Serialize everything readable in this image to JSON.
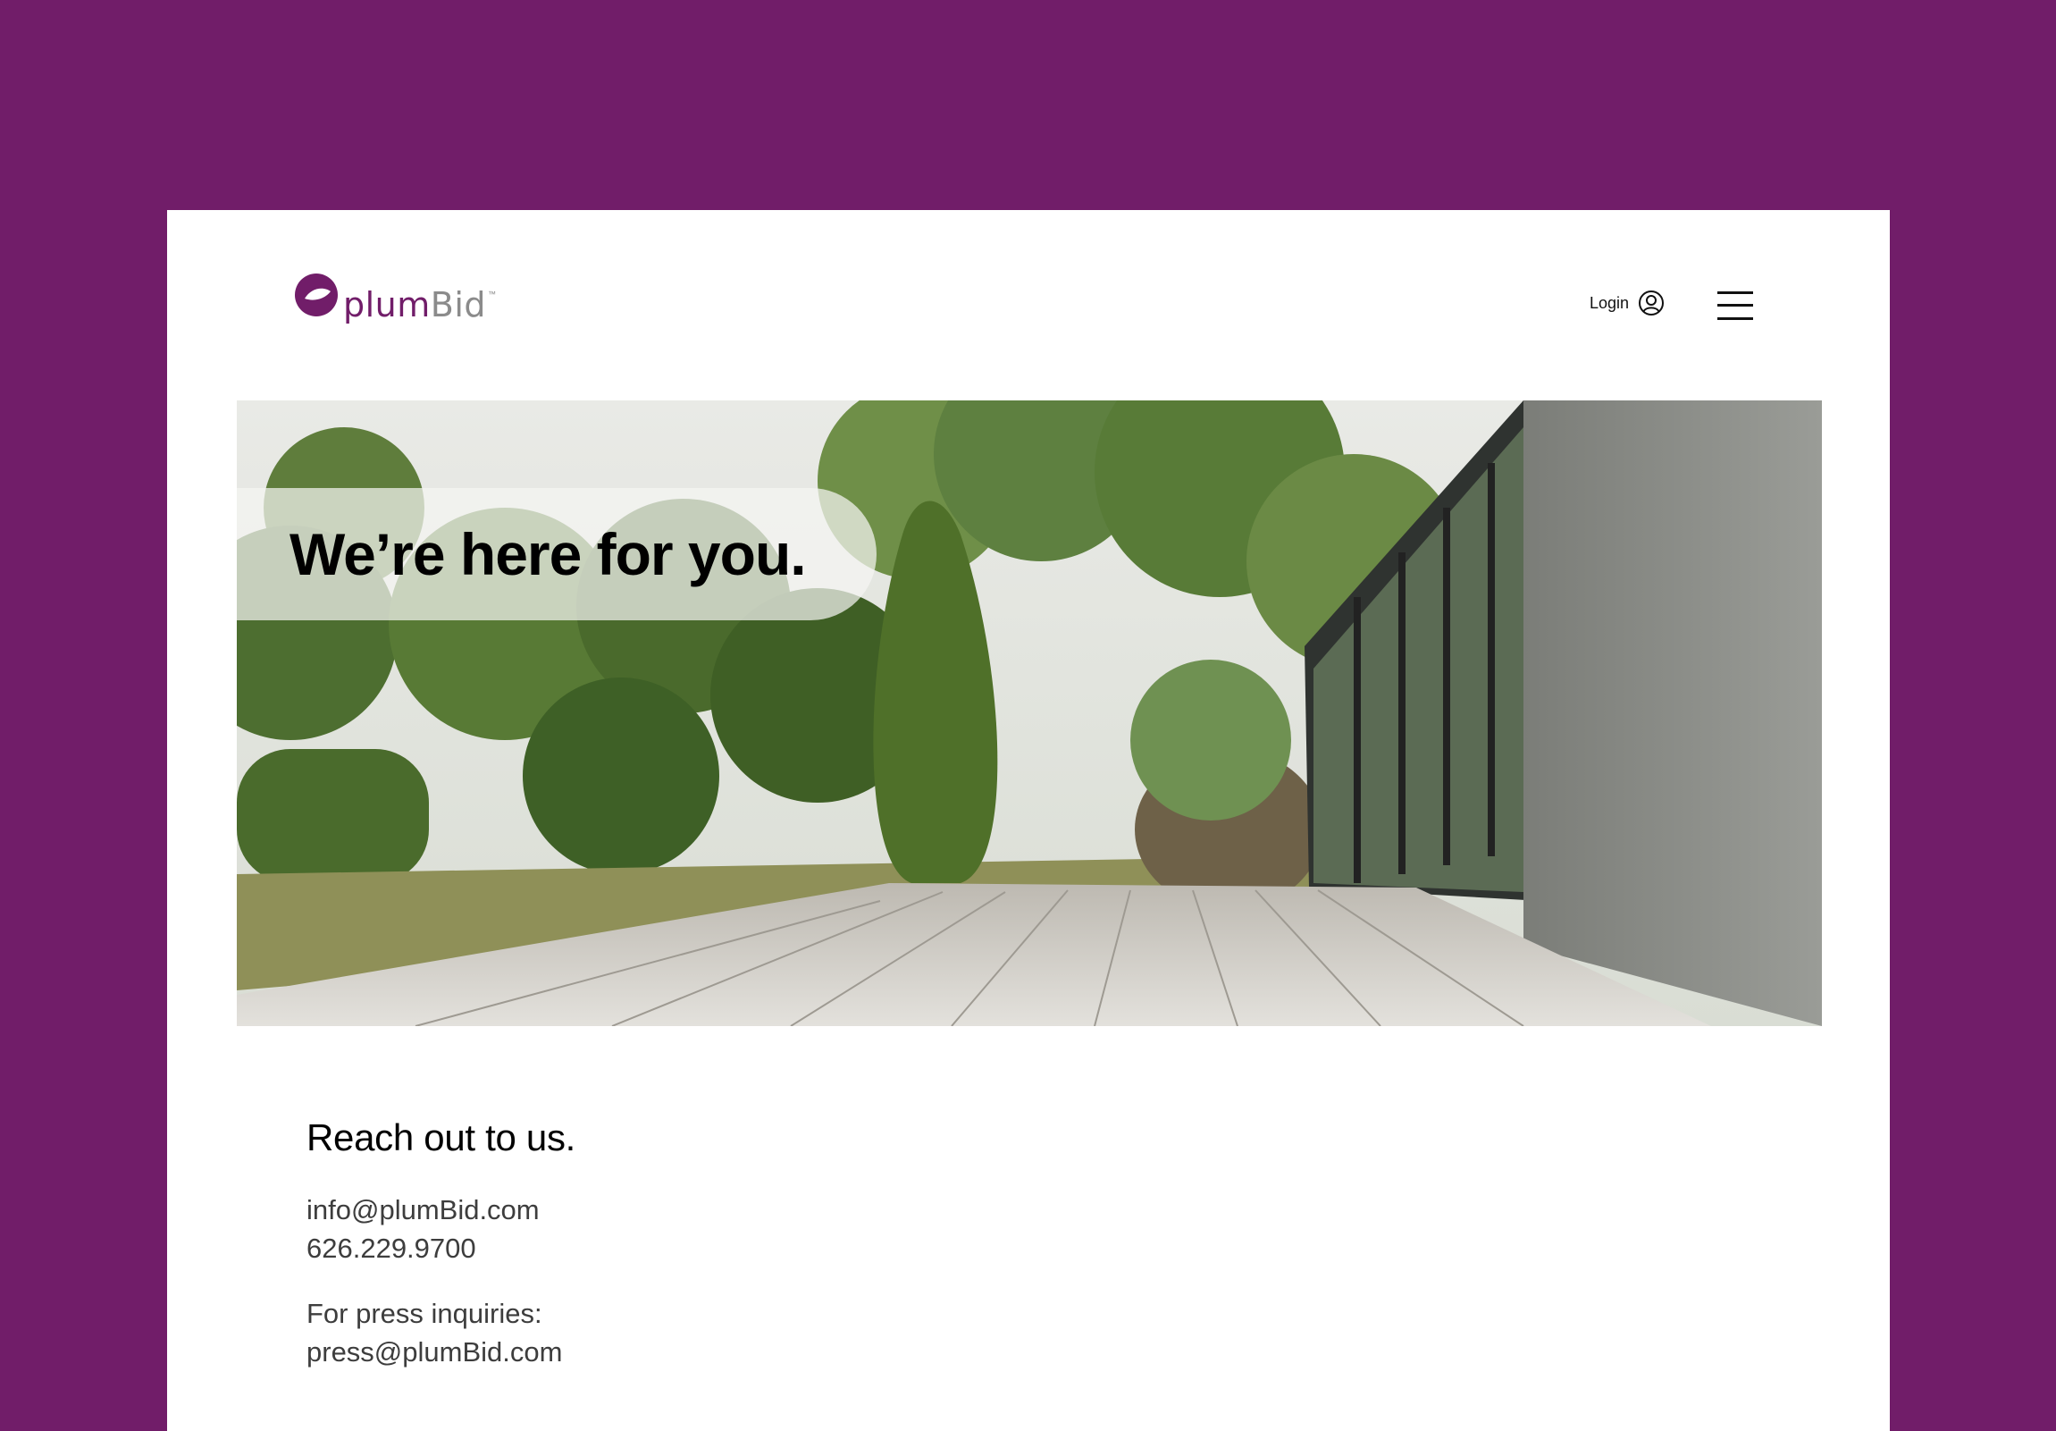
{
  "colors": {
    "brand": "#711d69",
    "background": "#ffffff",
    "body_text": "#3d3d3d"
  },
  "header": {
    "logo": {
      "plum": "plum",
      "bid": "Bid",
      "tm": "™"
    },
    "login_label": "Login",
    "icons": {
      "user": "user-circle-icon",
      "menu": "hamburger-menu-icon"
    }
  },
  "hero": {
    "title": "We’re here for you."
  },
  "contact": {
    "title": "Reach out to us.",
    "email": "info@plumBid.com",
    "phone": "626.229.9700",
    "press_label": "For press inquiries:",
    "press_email": "press@plumBid.com"
  }
}
